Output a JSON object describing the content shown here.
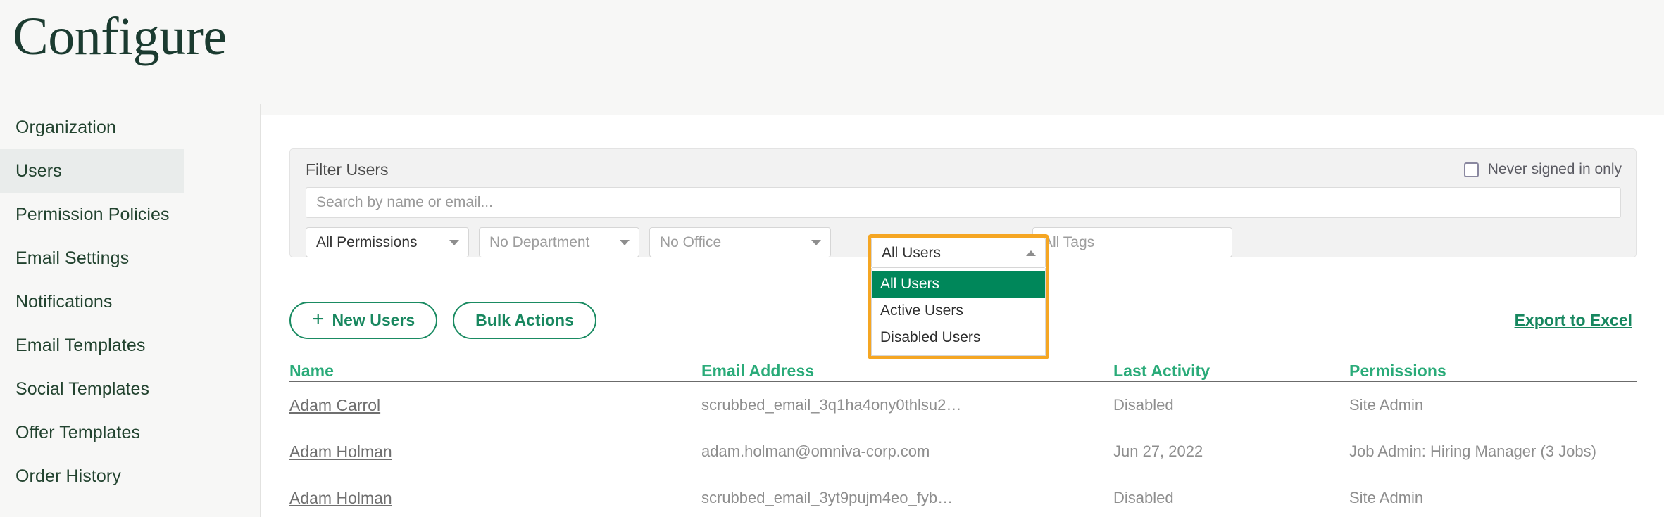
{
  "page": {
    "title": "Configure"
  },
  "sidebar": {
    "items": [
      {
        "label": "Organization",
        "active": false
      },
      {
        "label": "Users",
        "active": true
      },
      {
        "label": "Permission Policies",
        "active": false
      },
      {
        "label": "Email Settings",
        "active": false
      },
      {
        "label": "Notifications",
        "active": false
      },
      {
        "label": "Email Templates",
        "active": false
      },
      {
        "label": "Social Templates",
        "active": false
      },
      {
        "label": "Offer Templates",
        "active": false
      },
      {
        "label": "Order History",
        "active": false
      }
    ]
  },
  "filters": {
    "panel_label": "Filter Users",
    "never_signed_in_label": "Never signed in only",
    "never_signed_in_checked": false,
    "search_placeholder": "Search by name or email...",
    "search_value": "",
    "permissions_value": "All Permissions",
    "department_value": "No Department",
    "office_value": "No Office",
    "tags_placeholder": "All Tags",
    "tags_value": "",
    "user_status": {
      "selected": "All Users",
      "expanded": true,
      "options": [
        "All Users",
        "Active Users",
        "Disabled Users"
      ]
    }
  },
  "toolbar": {
    "new_users_label": "New Users",
    "new_users_icon": "plus-icon",
    "bulk_actions_label": "Bulk Actions",
    "export_label": "Export to Excel"
  },
  "table": {
    "columns": [
      "Name",
      "Email Address",
      "Last Activity",
      "Permissions"
    ],
    "rows": [
      {
        "name": "Adam Carrol",
        "email": "scrubbed_email_3q1ha4ony0thlsu2…",
        "last_activity": "Disabled",
        "permissions": "Site Admin"
      },
      {
        "name": "Adam Holman",
        "email": "adam.holman@omniva-corp.com",
        "last_activity": "Jun 27, 2022",
        "permissions": "Job Admin: Hiring Manager (3 Jobs)"
      },
      {
        "name": "Adam Holman",
        "email": "scrubbed_email_3yt9pujm4eo_fyb…",
        "last_activity": "Disabled",
        "permissions": "Site Admin"
      }
    ]
  },
  "colors": {
    "brand_green": "#17875f",
    "header_green": "#2aab79",
    "title_green": "#1b3b30",
    "highlight_orange": "#f5a623",
    "option_selected_green": "#00875a"
  }
}
